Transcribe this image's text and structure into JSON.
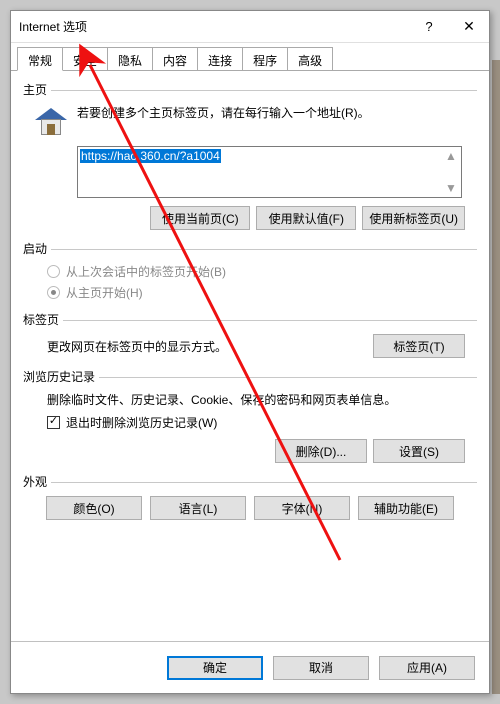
{
  "window": {
    "title": "Internet 选项"
  },
  "tabs": {
    "items": [
      "常规",
      "安全",
      "隐私",
      "内容",
      "连接",
      "程序",
      "高级"
    ],
    "active_index": 0
  },
  "homepage": {
    "section_title": "主页",
    "instruction": "若要创建多个主页标签页，请在每行输入一个地址(R)。",
    "url_value": "https://hao.360.cn/?a1004",
    "btn_current": "使用当前页(C)",
    "btn_default": "使用默认值(F)",
    "btn_newtab": "使用新标签页(U)"
  },
  "startup": {
    "section_title": "启动",
    "radio_last": "从上次会话中的标签页开始(B)",
    "radio_home": "从主页开始(H)",
    "selected": "home"
  },
  "tabpages": {
    "section_title": "标签页",
    "text": "更改网页在标签页中的显示方式。",
    "btn": "标签页(T)"
  },
  "history": {
    "section_title": "浏览历史记录",
    "text": "删除临时文件、历史记录、Cookie、保存的密码和网页表单信息。",
    "checkbox_label": "退出时删除浏览历史记录(W)",
    "checkbox_checked": true,
    "btn_delete": "删除(D)...",
    "btn_settings": "设置(S)"
  },
  "appearance": {
    "section_title": "外观",
    "btn_color": "颜色(O)",
    "btn_lang": "语言(L)",
    "btn_font": "字体(N)",
    "btn_access": "辅助功能(E)"
  },
  "footer": {
    "ok": "确定",
    "cancel": "取消",
    "apply": "应用(A)"
  }
}
